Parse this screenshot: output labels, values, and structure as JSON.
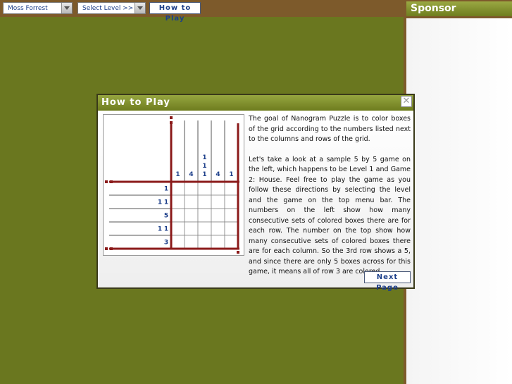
{
  "toolbar": {
    "player_select": "Moss Forrest",
    "level_select": "Select Level >>",
    "how_to_play_label": "How to Play"
  },
  "sponsor": {
    "title": "Sponsor"
  },
  "modal": {
    "title": "How to Play",
    "close_glyph": "✕",
    "paragraph_1": "The goal of Nanogram Puzzle is to color boxes of the grid according to the numbers listed next to the columns and rows of the grid.",
    "paragraph_2": "Let's take a look at a sample 5 by 5 game on the left, which happens to be Level 1 and Game 2: House. Feel free to play the game as you follow these directions by selecting the level and the game on the top menu bar. The numbers on the left show how many consecutive sets of colored boxes there are for each row. The number on the top show how many consecutive sets of colored boxes there are for each column. So the 3rd row shows a 5, and since there are only 5 boxes across for this game, it means all of row 3 are colored.",
    "next_label": "Next Page"
  },
  "puzzle": {
    "column_clues": [
      [
        "1"
      ],
      [
        "4"
      ],
      [
        "1",
        "1",
        "1"
      ],
      [
        "4"
      ],
      [
        "1"
      ]
    ],
    "row_clues": [
      [
        "1"
      ],
      [
        "1",
        "1"
      ],
      [
        "5"
      ],
      [
        "1",
        "1"
      ],
      [
        "3"
      ]
    ],
    "colors": {
      "frame": "#8b1a1a",
      "clue": "#1d3f8a"
    }
  }
}
